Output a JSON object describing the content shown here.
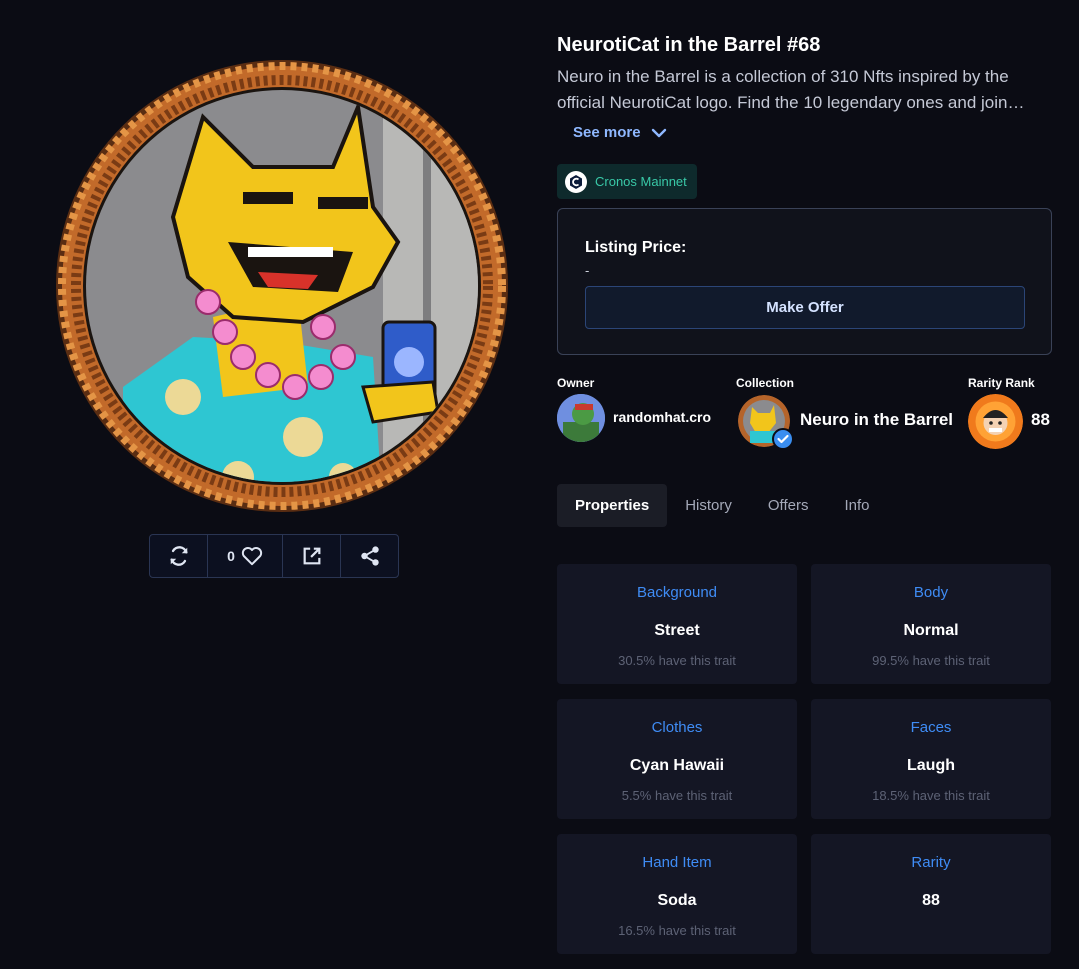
{
  "nft": {
    "title": "NeurotiCat in the Barrel #68",
    "description_line1": "Neuro in the Barrel is a collection of 310 Nfts inspired by the",
    "description_line2": "official NeurotiCat logo. Find the 10 legendary ones and join…",
    "see_more": "See more",
    "chain": "Cronos Mainnet"
  },
  "actions": {
    "likes": "0",
    "icons": [
      "refresh-icon",
      "heart-icon",
      "external-link-icon",
      "share-icon"
    ]
  },
  "listing": {
    "label": "Listing Price:",
    "value": "-",
    "offer_button": "Make Offer"
  },
  "meta": {
    "owner_label": "Owner",
    "owner_name": "randomhat.cro",
    "collection_label": "Collection",
    "collection_name": "Neuro in the Barrel",
    "rarity_label": "Rarity Rank",
    "rarity_value": "88"
  },
  "tabs": [
    "Properties",
    "History",
    "Offers",
    "Info"
  ],
  "traits": [
    {
      "name": "Background",
      "value": "Street",
      "percent": "30.5% have this trait"
    },
    {
      "name": "Body",
      "value": "Normal",
      "percent": "99.5% have this trait"
    },
    {
      "name": "Clothes",
      "value": "Cyan Hawaii",
      "percent": "5.5% have this trait"
    },
    {
      "name": "Faces",
      "value": "Laugh",
      "percent": "18.5% have this trait"
    },
    {
      "name": "Hand Item",
      "value": "Soda",
      "percent": "16.5% have this trait"
    },
    {
      "name": "Rarity",
      "value": "88",
      "percent": ""
    }
  ],
  "colors": {
    "background": "#0b0c14",
    "accent_blue": "#3f8cf5",
    "link_blue": "#8fb8ff",
    "chain_green": "#39c9a8",
    "card": "#141624"
  }
}
